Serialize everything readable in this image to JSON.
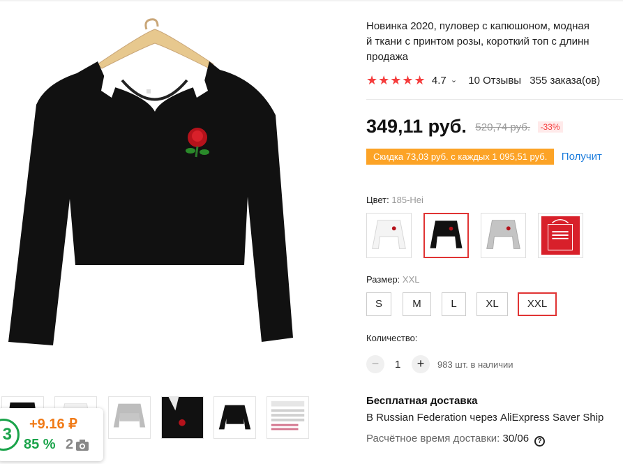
{
  "product": {
    "title_lines": [
      "Новинка 2020, пуловер с капюшоном, модная",
      "й ткани с принтом розы, короткий топ с длинн",
      "продажа"
    ],
    "rating": {
      "stars": "★★★★★",
      "value": "4.7",
      "reviews": "10 Отзывы",
      "orders": "355 заказа(ов)"
    },
    "price": {
      "current": "349,11 руб.",
      "old": "520,74 руб.",
      "discount": "-33%"
    },
    "coupon": {
      "text": "Скидка 73,03 руб. с каждых 1 095,51 руб.",
      "link": "Получит"
    },
    "color": {
      "label": "Цвет:",
      "value": "185-Hei",
      "selected_index": 1
    },
    "size": {
      "label": "Размер:",
      "value": "XXL",
      "options": [
        "S",
        "M",
        "L",
        "XL",
        "XXL"
      ],
      "selected_index": 4
    },
    "quantity": {
      "label": "Количество:",
      "minus": "−",
      "value": "1",
      "plus": "+",
      "stock": "983 шт. в наличии"
    },
    "shipping": {
      "title": "Бесплатная доставка",
      "line": "В Russian Federation через AliExpress Saver Ship",
      "time_label": "Расчётное время доставки:",
      "time_value": "30/06",
      "help_glyph": "?"
    }
  },
  "overlay": {
    "badge": "3",
    "bonus": "+9.16 ₽",
    "percent": "85 %",
    "photos": "2"
  },
  "icons": {
    "star": "star-icon",
    "chevron": "chevron-down-icon",
    "camera": "camera-icon",
    "help": "help-icon"
  },
  "colors": {
    "accent": "#f53d3d",
    "coupon": "#fca326",
    "link": "#1a7bdc",
    "selected_border": "#e03333",
    "good": "#1aa34a",
    "bonus": "#f07a17"
  }
}
